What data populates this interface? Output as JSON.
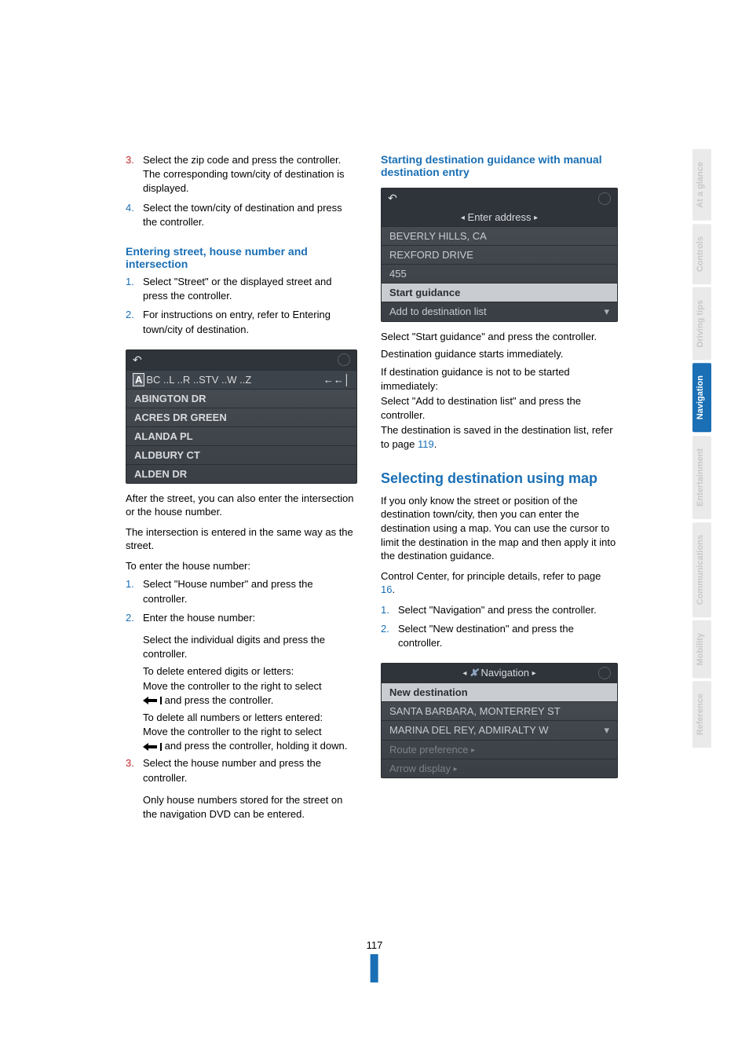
{
  "page_number": "117",
  "tabs": [
    {
      "label": "At a glance",
      "active": false
    },
    {
      "label": "Controls",
      "active": false
    },
    {
      "label": "Driving tips",
      "active": false
    },
    {
      "label": "Navigation",
      "active": true
    },
    {
      "label": "Entertainment",
      "active": false
    },
    {
      "label": "Communications",
      "active": false
    },
    {
      "label": "Mobility",
      "active": false
    },
    {
      "label": "Reference",
      "active": false
    }
  ],
  "left": {
    "list_top": [
      {
        "num": "3.",
        "red": true,
        "text": "Select the zip code and press the controller. The corresponding town/city of destination is displayed."
      },
      {
        "num": "4.",
        "red": false,
        "text": "Select the town/city of destination and press the controller."
      }
    ],
    "h_street": "Entering street, house number and intersection",
    "list_street": [
      {
        "num": "1.",
        "text": "Select \"Street\" or the displayed street and press the controller."
      },
      {
        "num": "2.",
        "text": "For instructions on entry, refer to Entering town/city of destination."
      }
    ],
    "ss1": {
      "charbar": "BC ..L ..R ..STV ..W ..Z",
      "rows": [
        "ABINGTON DR",
        "ACRES DR GREEN",
        "ALANDA PL",
        "ALDBURY CT",
        "ALDEN DR"
      ]
    },
    "after1": "After the street, you can also enter the intersection or the house number.",
    "after2": "The intersection is entered in the same way as the street.",
    "after3": "To enter the house number:",
    "hn_list": [
      {
        "num": "1.",
        "red": false,
        "text": "Select \"House number\" and press the controller."
      },
      {
        "num": "2.",
        "red": false,
        "text": "Enter the house number:"
      }
    ],
    "hn_2a": "Select the individual digits and press the controller.",
    "hn_2b_pre": "To delete entered digits or letters:\nMove the controller to the right to select",
    "hn_2b_post": " and press the controller.",
    "hn_2c_pre": "To delete all numbers or letters entered:\nMove the controller to the right to select",
    "hn_2c_post": " and press the controller, holding it down.",
    "hn3": {
      "num": "3.",
      "red": true,
      "text": "Select the house number and press the controller."
    },
    "hn_note": "Only house numbers stored for the street on the navigation DVD can be entered."
  },
  "right": {
    "h_start": "Starting destination guidance with manual destination entry",
    "ss2": {
      "title": "Enter address",
      "rows_top": [
        "BEVERLY HILLS, CA",
        "REXFORD DRIVE",
        "455"
      ],
      "highlight": "Start guidance",
      "row_bottom": "Add to destination list"
    },
    "para_a": "Select \"Start guidance\" and press the controller.",
    "para_b": "Destination guidance starts immediately.",
    "para_c": "If destination guidance is not to be started immediately:",
    "para_d": "Select \"Add to destination list\" and press the controller.",
    "para_e_pre": "The destination is saved in the destination list, refer to page ",
    "para_e_link": "119",
    "para_e_post": ".",
    "h_map": "Selecting destination using map",
    "map_p1": " If you only know the street or position of the destination town/city, then you can enter the destination using a map. You can use the cursor to limit the destination in the map and then apply it into the destination guidance.",
    "map_p2_pre": "Control Center, for principle details, refer to page ",
    "map_p2_link": "16",
    "map_p2_post": ".",
    "map_list": [
      {
        "num": "1.",
        "text": "Select \"Navigation\" and press the controller."
      },
      {
        "num": "2.",
        "text": "Select \"New destination\" and press the controller."
      }
    ],
    "ss3": {
      "title": "Navigation",
      "highlight": "New destination",
      "rows": [
        "SANTA BARBARA, MONTERREY ST",
        "MARINA DEL REY, ADMIRALTY W"
      ],
      "dim": [
        "Route preference",
        "Arrow display"
      ]
    }
  }
}
